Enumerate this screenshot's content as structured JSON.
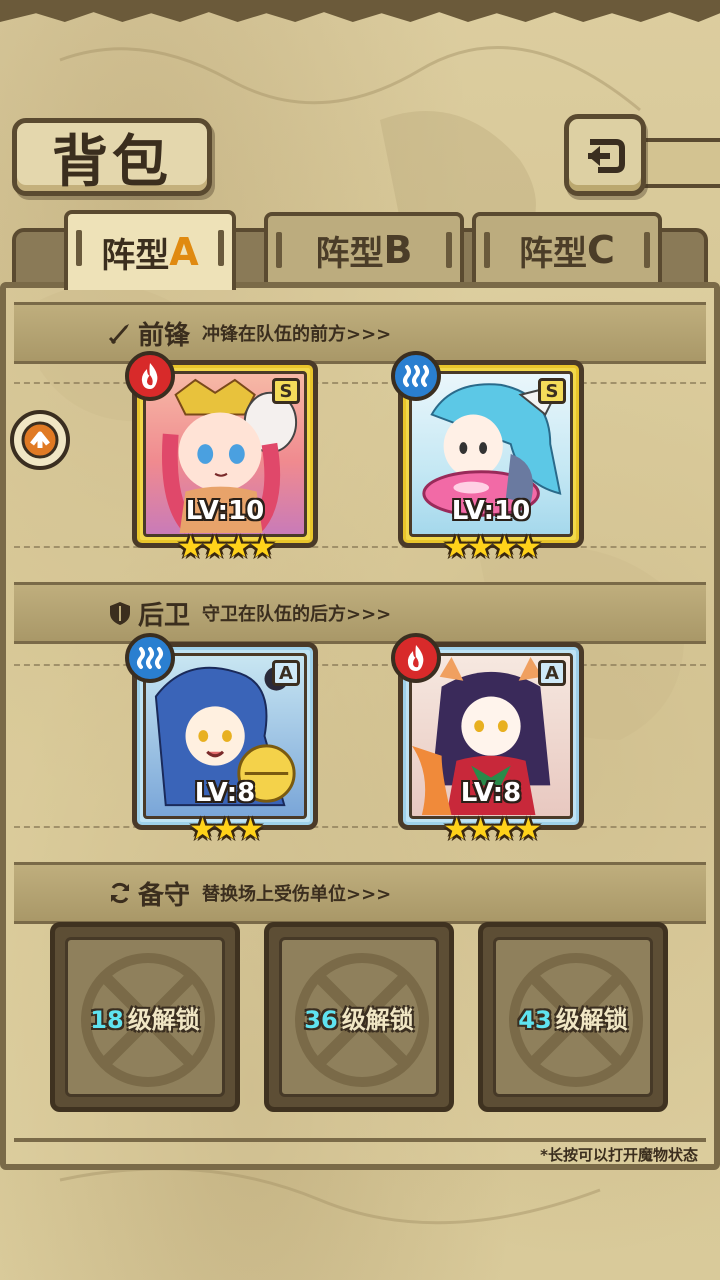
{
  "header": {
    "title": "背包"
  },
  "tabs": [
    {
      "label": "阵型",
      "letter": "A",
      "active": true
    },
    {
      "label": "阵型",
      "letter": "B",
      "active": false
    },
    {
      "label": "阵型",
      "letter": "C",
      "active": false
    }
  ],
  "sections": {
    "front": {
      "title": "前锋",
      "desc": "冲锋在队伍的前方>>>",
      "icon": "sword-icon"
    },
    "back": {
      "title": "后卫",
      "desc": "守卫在队伍的后方>>>",
      "icon": "shield-icon"
    },
    "reserve": {
      "title": "备守",
      "desc": "替换场上受伤单位>>>",
      "icon": "swap-icon"
    }
  },
  "cards": [
    {
      "name": "front-left",
      "element": "fire",
      "rank": "S",
      "level": "LV:10",
      "stars": "★★★★",
      "frame": "gold"
    },
    {
      "name": "front-right",
      "element": "water",
      "rank": "S",
      "level": "LV:10",
      "stars": "★★★★",
      "frame": "gold"
    },
    {
      "name": "back-left",
      "element": "water",
      "rank": "A",
      "level": "LV:8",
      "stars": "★★★",
      "frame": "blue"
    },
    {
      "name": "back-right",
      "element": "fire",
      "rank": "A",
      "level": "LV:8",
      "stars": "★★★★",
      "frame": "blue"
    }
  ],
  "locked_slots": [
    {
      "number": "18",
      "text": "级解锁"
    },
    {
      "number": "36",
      "text": "级解锁"
    },
    {
      "number": "43",
      "text": "级解锁"
    }
  ],
  "footer": {
    "note": "*长按可以打开魔物状态"
  },
  "colors": {
    "fire": "#d82a2a",
    "water": "#2a7fd0",
    "active_tab_letter": "#e08a10",
    "unlock_number": "#5fe3f0"
  }
}
